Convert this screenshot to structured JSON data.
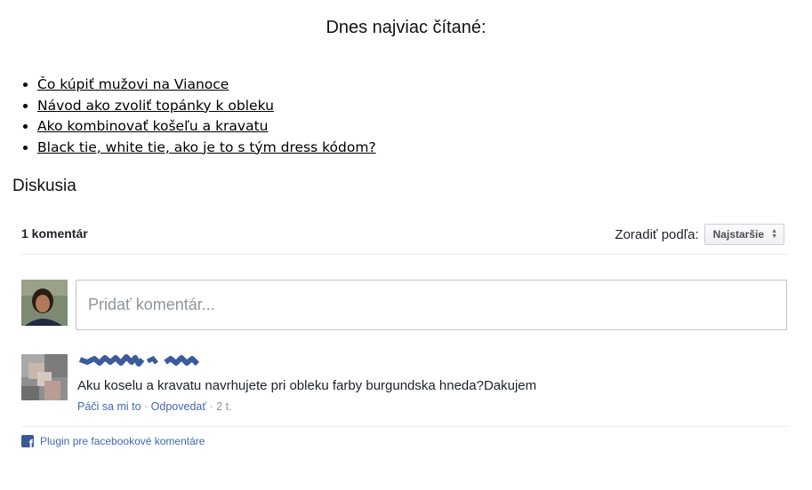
{
  "most_read": {
    "title": "Dnes najviac čítané:",
    "items": [
      {
        "label": "Čo kúpiť mužovi na Vianoce"
      },
      {
        "label": "Návod ako zvoliť topánky k obleku"
      },
      {
        "label": "Ako kombinovať košeľu a kravatu"
      },
      {
        "label": "Black tie, white tie, ako je to s tým dress kódom?"
      }
    ]
  },
  "discussion": {
    "heading": "Diskusia",
    "comment_count": "1 komentár",
    "sort_label": "Zoradiť podľa:",
    "sort_value": "Najstaršie",
    "composer": {
      "placeholder": "Pridať komentár..."
    },
    "comments": [
      {
        "text": "Aku koselu a kravatu navrhujete pri obleku farby burgundska hneda?Dakujem",
        "like": "Páči sa mi to",
        "separator": " · ",
        "reply": "Odpovedať",
        "time": " · 2 t."
      }
    ],
    "footer": {
      "icon": "facebook-icon",
      "label": "Plugin pre facebookové komentáre"
    }
  },
  "colors": {
    "link_blue": "#4267b2",
    "facebook_blue": "#3b5998",
    "border": "#bec3c9",
    "muted": "#90949c"
  }
}
